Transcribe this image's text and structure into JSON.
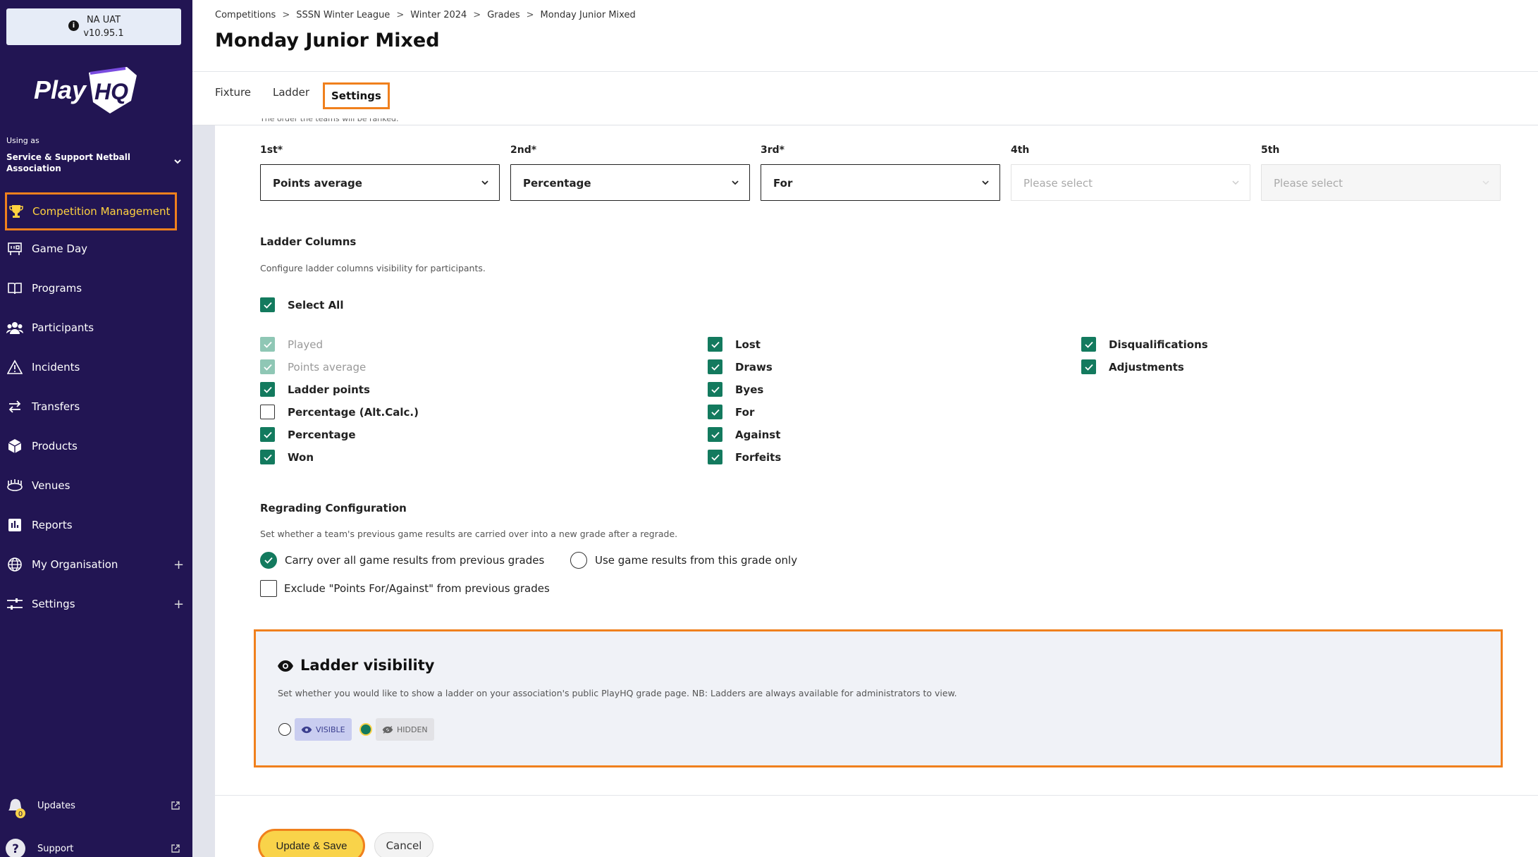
{
  "env": {
    "name": "NA UAT",
    "version": "v10.95.1"
  },
  "brand": {
    "logo_text": "Play",
    "logo_mark": "HQ"
  },
  "org": {
    "using_label": "Using as",
    "name_line1": "Service & Support Netball",
    "name_line2": "Association"
  },
  "nav": [
    {
      "label": "Competition Management",
      "icon": "trophy-icon",
      "active": true
    },
    {
      "label": "Game Day",
      "icon": "scoreboard-icon"
    },
    {
      "label": "Programs",
      "icon": "book-icon"
    },
    {
      "label": "Participants",
      "icon": "people-icon"
    },
    {
      "label": "Incidents",
      "icon": "warning-icon"
    },
    {
      "label": "Transfers",
      "icon": "transfer-icon"
    },
    {
      "label": "Products",
      "icon": "box-icon"
    },
    {
      "label": "Venues",
      "icon": "stadium-icon"
    },
    {
      "label": "Reports",
      "icon": "chart-icon"
    },
    {
      "label": "My Organisation",
      "icon": "globe-icon",
      "expand": "+"
    },
    {
      "label": "Settings",
      "icon": "sliders-icon",
      "expand": "+"
    }
  ],
  "bottom_nav": {
    "updates": "Updates",
    "support": "Support",
    "badge": "0"
  },
  "breadcrumb": [
    "Competitions",
    "SSSN Winter League",
    "Winter 2024",
    "Grades",
    "Monday Junior Mixed"
  ],
  "page_title": "Monday Junior Mixed",
  "tabs": [
    "Fixture",
    "Ladder",
    "Settings"
  ],
  "ranking": {
    "cut_text": "The order the teams will be ranked.",
    "slots": [
      {
        "label": "1st*",
        "value": "Points average"
      },
      {
        "label": "2nd*",
        "value": "Percentage"
      },
      {
        "label": "3rd*",
        "value": "For"
      },
      {
        "label": "4th",
        "value": "Please select"
      },
      {
        "label": "5th",
        "value": "Please select"
      }
    ]
  },
  "ladder_columns": {
    "title": "Ladder Columns",
    "desc": "Configure ladder columns visibility for participants.",
    "select_all": "Select All",
    "col1": [
      "Played",
      "Points average",
      "Ladder points",
      "Percentage (Alt.Calc.)",
      "Percentage",
      "Won"
    ],
    "col2": [
      "Lost",
      "Draws",
      "Byes",
      "For",
      "Against",
      "Forfeits"
    ],
    "col3": [
      "Disqualifications",
      "Adjustments"
    ]
  },
  "regrading": {
    "title": "Regrading Configuration",
    "desc": "Set whether a team's previous game results are carried over into a new grade after a regrade.",
    "opt1": "Carry over all game results from previous grades",
    "opt2": "Use game results from this grade only",
    "exclude": "Exclude \"Points For/Against\" from previous grades"
  },
  "visibility": {
    "title": "Ladder visibility",
    "desc": "Set whether you would like to show a ladder on your association's public PlayHQ grade page. NB: Ladders are always available for administrators to view.",
    "visible": "VISIBLE",
    "hidden": "HIDDEN"
  },
  "actions": {
    "save": "Update & Save",
    "cancel": "Cancel"
  },
  "colors": {
    "sidebar": "#221553",
    "accent": "#f0801d",
    "check": "#137a5e",
    "save": "#f9d34a"
  }
}
